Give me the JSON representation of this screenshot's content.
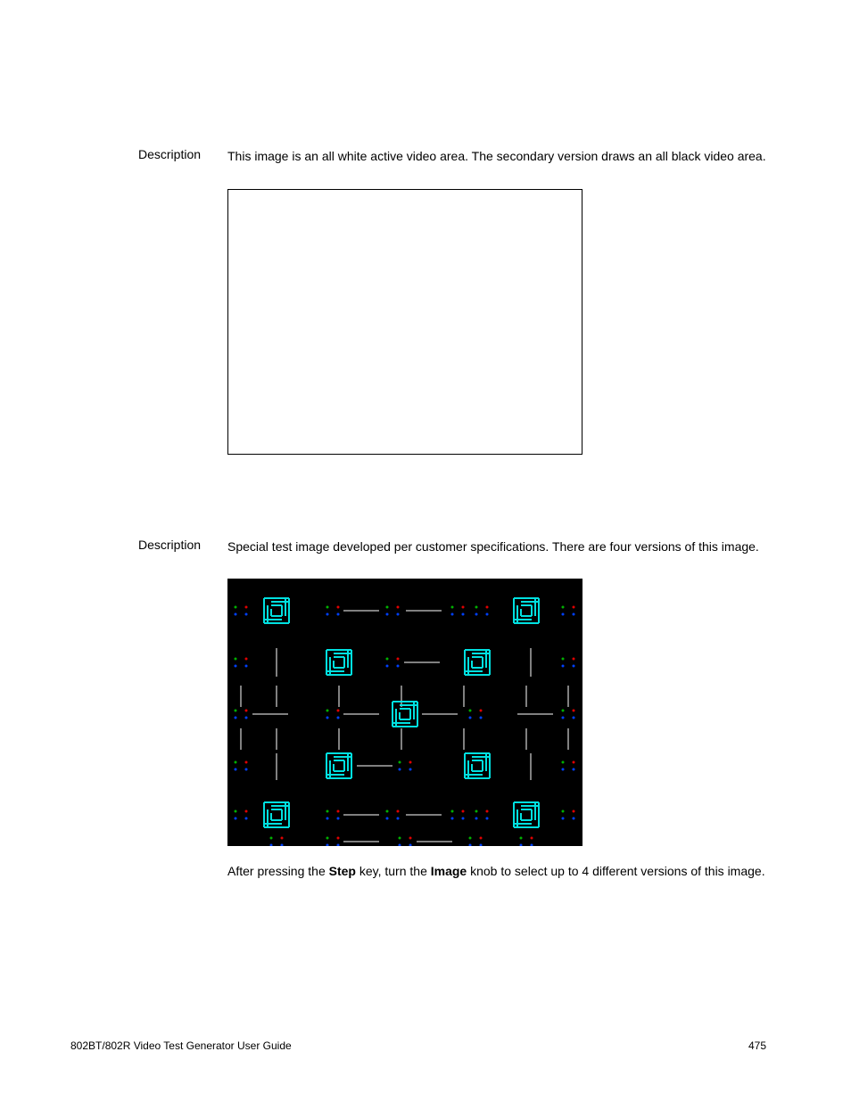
{
  "section1": {
    "label": "Description",
    "text": "This image is an all white active video area. The secondary version draws an all black video area."
  },
  "section2": {
    "label": "Description",
    "text": "Special test image developed per customer specifications. There are four versions of this image.",
    "instruction_pre": "After pressing the ",
    "instruction_key1": "Step",
    "instruction_mid": " key, turn the ",
    "instruction_key2": "Image",
    "instruction_post": " knob to select up to 4 different versions of this image."
  },
  "footer": {
    "text": "802BT/802R Video Test Generator User Guide",
    "page": "475"
  }
}
